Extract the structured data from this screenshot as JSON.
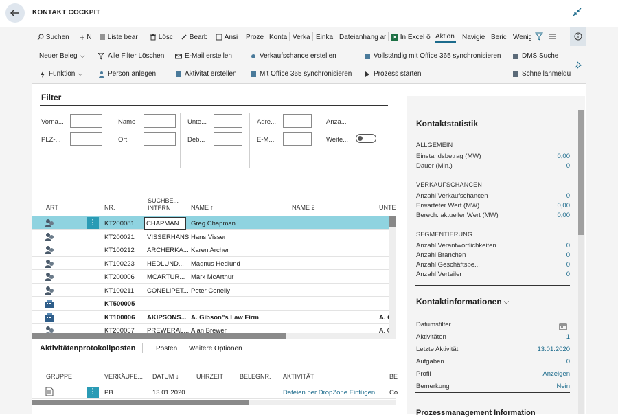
{
  "title": "KONTAKT COCKPIT",
  "toolbar": {
    "search": "Suchen",
    "new": "N",
    "list_edit": "Liste bear",
    "delete": "Lösc",
    "edit": "Bearb",
    "view": "Ansi",
    "process": "Proze",
    "contact": "Konta",
    "sales": "Verka",
    "purchase": "Einka",
    "attachment": "Dateianhang ar",
    "excel": "In Excel ö",
    "actions": "Aktion",
    "navigate": "Navigie",
    "report": "Beric",
    "fewer": "Wenig"
  },
  "actions_row1": {
    "new_doc": "Neuer Beleg",
    "clear_filters": "Alle Filter Löschen",
    "email": "E-Mail erstellen",
    "opportunity": "Verkaufschance erstellen",
    "sync365": "Vollständig mit Office 365 synchronisieren",
    "dms": "DMS Suche"
  },
  "actions_row2": {
    "function": "Funktion",
    "add_person": "Person anlegen",
    "activity": "Aktivität erstellen",
    "sync365_2": "Mit Office 365 synchronisieren",
    "start_process": "Prozess starten",
    "quick_register": "Schnellanmeldu"
  },
  "filter": {
    "heading": "Filter",
    "col1": [
      "Vorna...",
      "PLZ-..."
    ],
    "col2": [
      "Name",
      "Ort"
    ],
    "col3": [
      "Unte...",
      "Deb..."
    ],
    "col4": [
      "Adre...",
      "E-M..."
    ],
    "col5": [
      "Anza...",
      "Weite..."
    ]
  },
  "table": {
    "headers": {
      "type": "ART",
      "no": "NR.",
      "search1": "SUCHBE...",
      "search2": "INTERN",
      "name": "NAME ↑",
      "name2": "NAME 2",
      "company": "UNTE"
    },
    "rows": [
      {
        "no": "KT200081",
        "search": "CHAPMAN...",
        "name": "Greg Chapman",
        "name2": "",
        "company": ""
      },
      {
        "no": "KT200021",
        "search": "VISSERHANS",
        "name": "Hans Visser",
        "name2": "",
        "company": ""
      },
      {
        "no": "KT100212",
        "search": "ARCHERKA...",
        "name": "Karen Archer",
        "name2": "",
        "company": ""
      },
      {
        "no": "KT100223",
        "search": "HEDLUND...",
        "name": "Magnus Hedlund",
        "name2": "",
        "company": ""
      },
      {
        "no": "KT200006",
        "search": "MCARTUR...",
        "name": "Mark McArthur",
        "name2": "",
        "company": ""
      },
      {
        "no": "KT100211",
        "search": "CONELIPET...",
        "name": "Peter Conelly",
        "name2": "",
        "company": ""
      },
      {
        "no": "KT500005",
        "search": "",
        "name": "",
        "name2": "",
        "company": ""
      },
      {
        "no": "KT100006",
        "search": "AKIPSONS...",
        "name": "A. Gibson\"s Law Firm",
        "name2": "",
        "company": "A. G"
      },
      {
        "no": "KT200057",
        "search": "PREWERAL...",
        "name": "Alan Brewer",
        "name2": "",
        "company": "A. G"
      }
    ]
  },
  "activity": {
    "heading": "Aktivitätenprotokollposten",
    "tab_posts": "Posten",
    "tab_more": "Weitere Optionen",
    "headers": {
      "group": "GRUPPE",
      "seller": "VERKÄUFE...",
      "date": "DATUM ↓",
      "time": "UHRZEIT",
      "docno": "BELEGNR.",
      "activity": "AKTIVITÄT",
      "extra": "BE"
    },
    "row": {
      "seller": "PB",
      "date": "13.01.2020",
      "activity": "Dateien per DropZone Einfügen",
      "extra": "Co"
    }
  },
  "stats": {
    "heading": "Kontaktstatistik",
    "general": {
      "title": "ALLGEMEIN",
      "items": [
        {
          "label": "Einstandsbetrag (MW)",
          "value": "0,00"
        },
        {
          "label": "Dauer (Min.)",
          "value": "0"
        }
      ]
    },
    "sales": {
      "title": "VERKAUFSCHANCEN",
      "items": [
        {
          "label": "Anzahl Verkaufschancen",
          "value": "0"
        },
        {
          "label": "Erwarteter Wert (MW)",
          "value": "0,00"
        },
        {
          "label": "Berech. aktueller Wert (MW)",
          "value": "0,00"
        }
      ]
    },
    "segment": {
      "title": "SEGMENTIERUNG",
      "items": [
        {
          "label": "Anzahl Verantwortlichkeiten",
          "value": "0"
        },
        {
          "label": "Anzahl Branchen",
          "value": "0"
        },
        {
          "label": "Anzahl Geschäftsbe...",
          "value": "0"
        },
        {
          "label": "Anzahl Verteiler",
          "value": "0"
        }
      ]
    }
  },
  "contact_info": {
    "heading": "Kontaktinformationen",
    "items": [
      {
        "label": "Datumsfilter",
        "value": ""
      },
      {
        "label": "Aktivitäten",
        "value": "1"
      },
      {
        "label": "Letzte Aktivität",
        "value": "13.01.2020"
      },
      {
        "label": "Aufgaben",
        "value": "0"
      },
      {
        "label": "Profil",
        "value": "Anzeigen"
      },
      {
        "label": "Bemerkung",
        "value": "Nein"
      }
    ],
    "next_heading": "Prozessmanagement Information"
  },
  "colors": {
    "accent": "#1c6b8c",
    "selected_row": "#8fd3e0",
    "background": "#f4f4f4"
  }
}
